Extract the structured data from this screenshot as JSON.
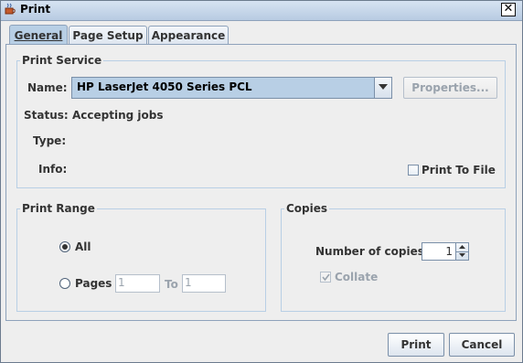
{
  "window": {
    "title": "Print",
    "close_symbol": "✕"
  },
  "tabs": [
    {
      "label": "General",
      "mnemonic_index": 0
    },
    {
      "label": "Page Setup",
      "mnemonic_index": 5
    },
    {
      "label": "Appearance",
      "mnemonic_index": 0
    }
  ],
  "print_service": {
    "legend": "Print Service",
    "name_label": "Name:",
    "printer": "HP LaserJet 4050 Series PCL",
    "properties_button": "Properties...",
    "status_label": "Status:",
    "status_value": "Accepting jobs",
    "type_label": "Type:",
    "info_label": "Info:",
    "print_to_file_label": "Print To File"
  },
  "print_range": {
    "legend": "Print Range",
    "all_label": "All",
    "pages_label": "Pages",
    "from_value": "1",
    "to_label": "To",
    "to_value": "1"
  },
  "copies": {
    "legend": "Copies",
    "number_label": "Number of copies:",
    "number_value": "1",
    "collate_label": "Collate"
  },
  "buttons": {
    "print": "Print",
    "cancel": "Cancel"
  },
  "colors": {
    "accent": "#b8cfe5",
    "border": "#8ea2bb",
    "background": "#eeeeee"
  }
}
